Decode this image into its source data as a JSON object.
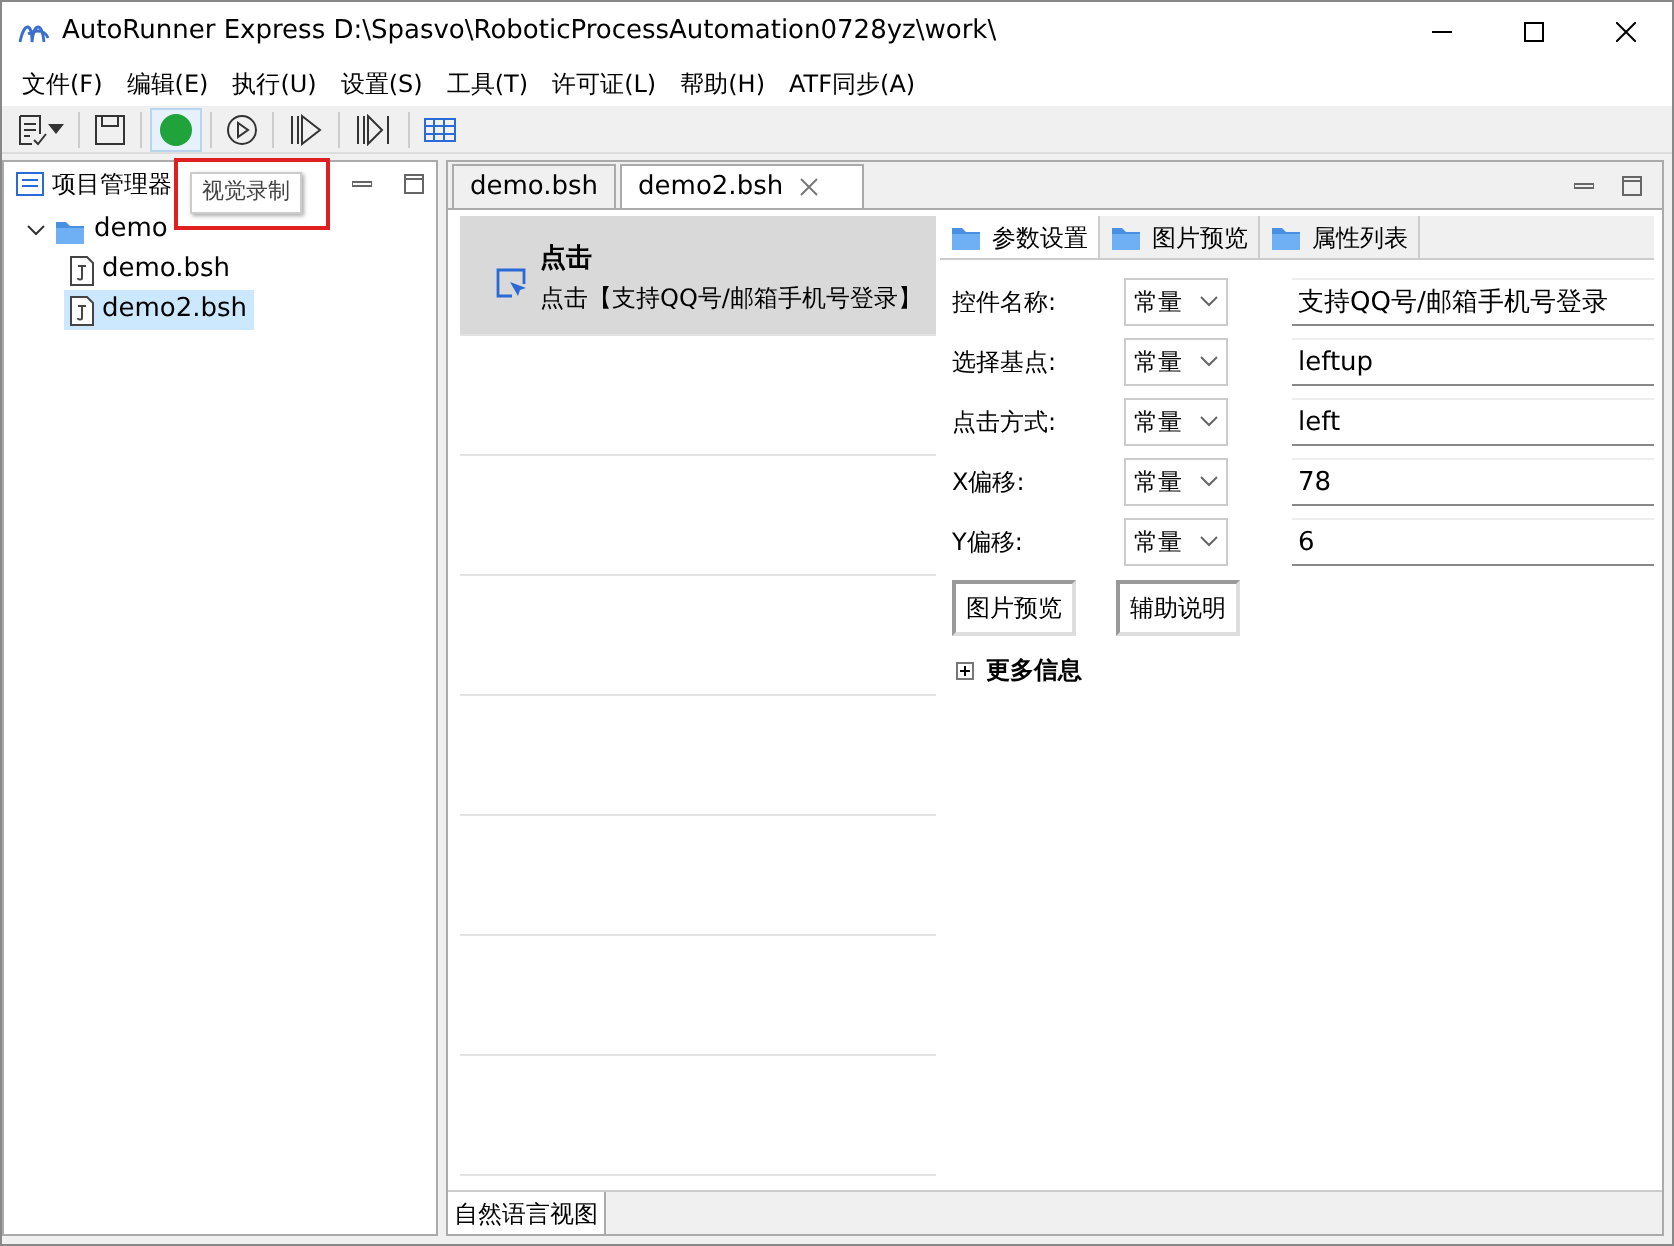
{
  "window": {
    "title": "AutoRunner Express   D:\\Spasvo\\RoboticProcessAutomation0728yz\\work\\"
  },
  "menu": [
    "文件(F)",
    "编辑(E)",
    "执行(U)",
    "设置(S)",
    "工具(T)",
    "许可证(L)",
    "帮助(H)",
    "ATF同步(A)"
  ],
  "tooltip": {
    "text": "视觉录制",
    "highlighted": true
  },
  "project_panel": {
    "title": "项目管理器",
    "tree": [
      {
        "label": "demo",
        "kind": "folder",
        "expanded": true,
        "selected": false,
        "children": [
          {
            "label": "demo.bsh",
            "kind": "file",
            "selected": false
          },
          {
            "label": "demo2.bsh",
            "kind": "file",
            "selected": true
          }
        ]
      }
    ]
  },
  "editor_tabs": [
    {
      "label": "demo.bsh",
      "selected": false
    },
    {
      "label": "demo2.bsh",
      "selected": true,
      "closable": true
    }
  ],
  "steps": [
    {
      "title": "点击",
      "description": "点击【支持QQ号/邮箱手机号登录】",
      "selected": true
    }
  ],
  "property_tabs": [
    {
      "label": "参数设置",
      "selected": true
    },
    {
      "label": "图片预览",
      "selected": false
    },
    {
      "label": "属性列表",
      "selected": false
    }
  ],
  "params": [
    {
      "label": "控件名称:",
      "mode": "常量",
      "value": "支持QQ号/邮箱手机号登录"
    },
    {
      "label": "选择基点:",
      "mode": "常量",
      "value": "leftup"
    },
    {
      "label": "点击方式:",
      "mode": "常量",
      "value": "left"
    },
    {
      "label": "X偏移:",
      "mode": "常量",
      "value": "78"
    },
    {
      "label": "Y偏移:",
      "mode": "常量",
      "value": "6"
    }
  ],
  "param_buttons": [
    "图片预览",
    "辅助说明"
  ],
  "more_info": {
    "label": "更多信息",
    "expanded": false
  },
  "bottom_tabs": [
    {
      "label": "自然语言视图",
      "selected": true
    }
  ]
}
